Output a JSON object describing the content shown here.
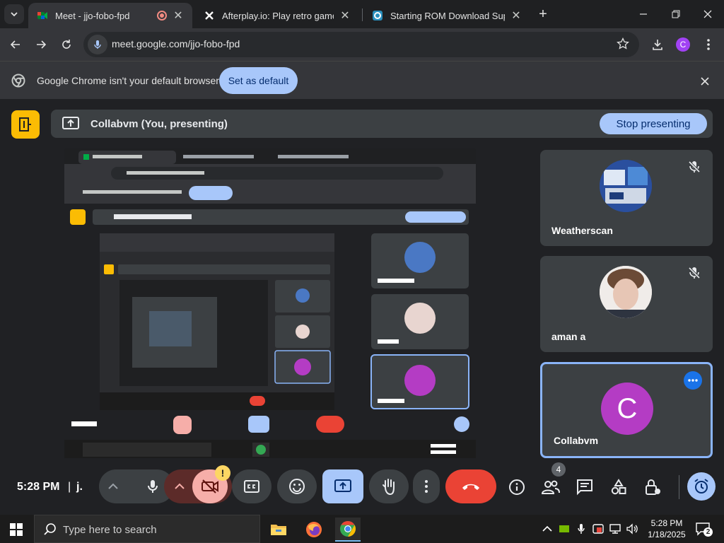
{
  "browser": {
    "tabs": [
      {
        "title": "Meet - jjo-fobo-fpd",
        "active": true
      },
      {
        "title": "Afterplay.io: Play retro games o",
        "active": false
      },
      {
        "title": "Starting ROM Download Super",
        "active": false
      }
    ],
    "url": "meet.google.com/jjo-fobo-fpd",
    "profile_initial": "C"
  },
  "infobar": {
    "message": "Google Chrome isn't your default browser",
    "button": "Set as default"
  },
  "meet": {
    "presenting_text": "Collabvm (You, presenting)",
    "stop_button": "Stop presenting",
    "participants": [
      {
        "name": "Weatherscan",
        "muted": true
      },
      {
        "name": "aman a",
        "muted": true
      },
      {
        "name": "Collabvm",
        "initial": "C",
        "active": true
      }
    ],
    "time": "5:28 PM",
    "separator": "|",
    "meeting_code": "j.",
    "participant_count": "4",
    "warning_badge": "!"
  },
  "taskbar": {
    "search_placeholder": "Type here to search",
    "time": "5:28 PM",
    "date": "1/18/2025",
    "notification_count": "2"
  },
  "colors": {
    "accent": "#a8c7fa",
    "end_call": "#ea4335",
    "avatar_c": "#b43cc4",
    "meet_logo": "#fbbc04"
  }
}
